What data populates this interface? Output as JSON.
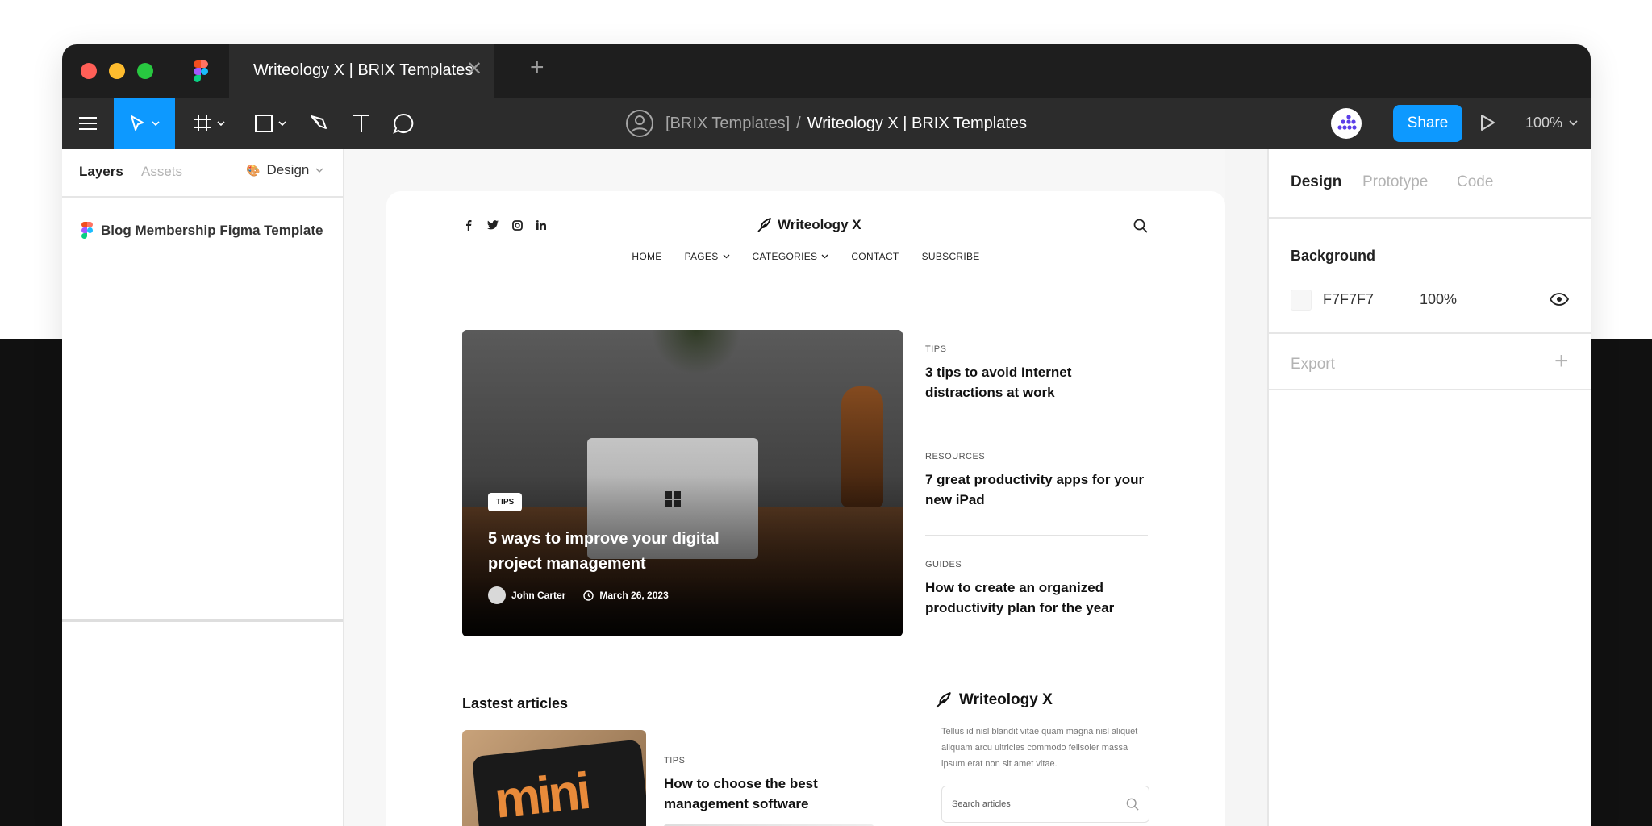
{
  "window": {
    "tab_title": "Writeology X | BRIX Templates",
    "tab_close": "✕",
    "tab_add": "+"
  },
  "toolbar": {
    "team": "[BRIX Templates]",
    "separator": "/",
    "file": "Writeology X | BRIX Templates",
    "share_label": "Share",
    "zoom": "100%"
  },
  "left_panel": {
    "tabs": [
      "Layers",
      "Assets"
    ],
    "active_tab": "Layers",
    "design_label": "Design",
    "layers": [
      {
        "name": "Blog Membership Figma Template"
      }
    ]
  },
  "site": {
    "logo": "Writeology X",
    "socials": [
      "f",
      "t",
      "ig",
      "in"
    ],
    "nav": [
      {
        "label": "HOME",
        "dropdown": false
      },
      {
        "label": "PAGES",
        "dropdown": true
      },
      {
        "label": "CATEGORIES",
        "dropdown": true
      },
      {
        "label": "CONTACT",
        "dropdown": false
      },
      {
        "label": "SUBSCRIBE",
        "dropdown": false
      }
    ],
    "hero": {
      "badge": "TIPS",
      "title": "5 ways to improve your digital project management",
      "author": "John Carter",
      "date": "March 26, 2023"
    },
    "side_posts": [
      {
        "category": "TIPS",
        "title": "3 tips to avoid Internet distractions at work"
      },
      {
        "category": "RESOURCES",
        "title": "7 great productivity apps for your new iPad"
      },
      {
        "category": "GUIDES",
        "title": "How to create an organized productivity plan for the year"
      }
    ],
    "latest": {
      "heading": "Lastest articles",
      "thumb_text": "mini",
      "post": {
        "category": "TIPS",
        "title": "How to choose the best management software"
      }
    },
    "widget": {
      "logo": "Writeology X",
      "text": "Tellus id nisl blandit vitae quam magna nisl aliquet aliquam arcu ultricies commodo felisoler massa ipsum erat non sit amet vitae.",
      "search_placeholder": "Search articles"
    }
  },
  "right_panel": {
    "tabs": [
      "Design",
      "Prototype",
      "Code"
    ],
    "active_tab": "Design",
    "background_title": "Background",
    "background_hex": "F7F7F7",
    "background_opacity": "100%",
    "export_label": "Export",
    "export_add": "+"
  },
  "colors": {
    "accent": "#0d99ff",
    "chrome_dark": "#1e1e1e",
    "toolbar": "#2c2c2c",
    "canvas_bg": "#F7F7F7"
  }
}
